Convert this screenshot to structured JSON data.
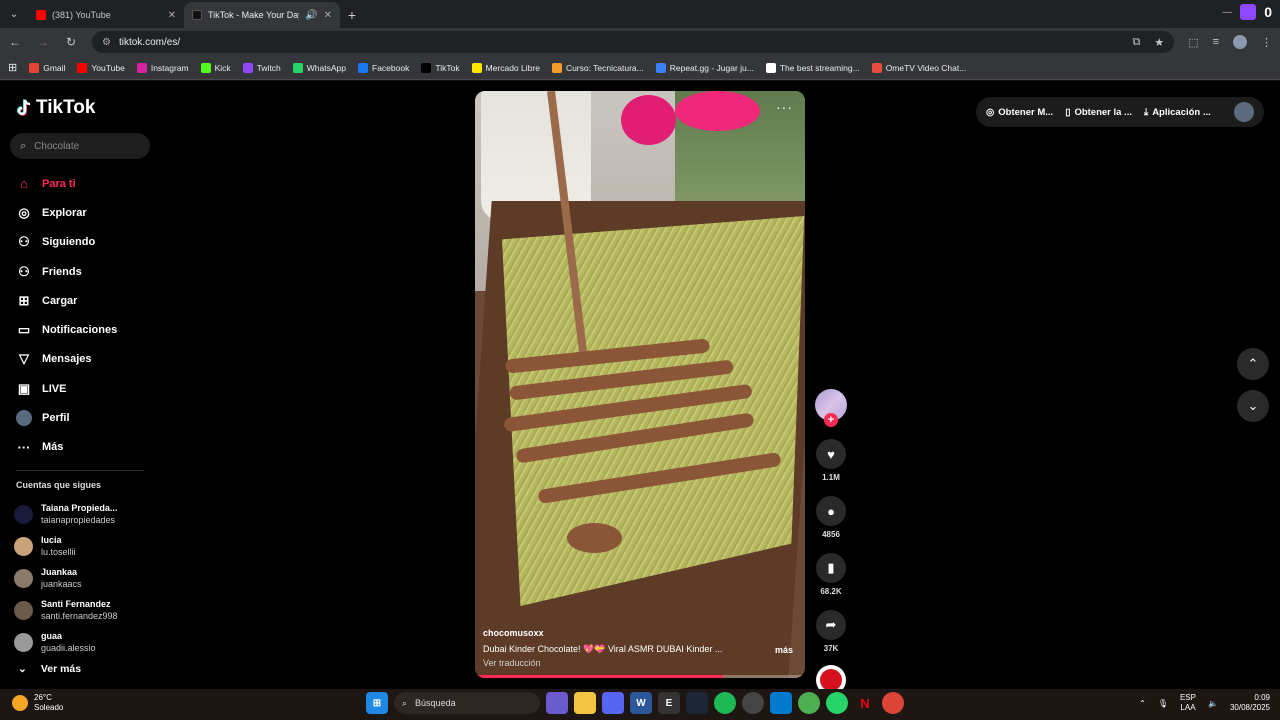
{
  "browser": {
    "tabs": [
      {
        "title": "(381) YouTube",
        "active": false,
        "color": "#ff0000"
      },
      {
        "title": "TikTok - Make Your Day",
        "active": true,
        "color": "#000000"
      }
    ],
    "url": "tiktok.com/es/",
    "bookmarks": [
      {
        "label": "Gmail",
        "color": "#ea4335"
      },
      {
        "label": "YouTube",
        "color": "#ff0000"
      },
      {
        "label": "Instagram",
        "color": "#d6249f"
      },
      {
        "label": "Kick",
        "color": "#53fc18"
      },
      {
        "label": "Twitch",
        "color": "#9146ff"
      },
      {
        "label": "WhatsApp",
        "color": "#25d366"
      },
      {
        "label": "Facebook",
        "color": "#1877f2"
      },
      {
        "label": "TikTok",
        "color": "#000000"
      },
      {
        "label": "Mercado Libre",
        "color": "#ffe600"
      },
      {
        "label": "Curso: Tecnicatura...",
        "color": "#f29b2a"
      },
      {
        "label": "Repeat.gg - Jugar ju...",
        "color": "#3b82f6"
      },
      {
        "label": "The best streaming...",
        "color": "#ffffff"
      },
      {
        "label": "OmeTV Video Chat...",
        "color": "#e74c3c"
      }
    ],
    "badge_count": "0"
  },
  "tiktok": {
    "logo": "TikTok",
    "search_placeholder": "Chocolate",
    "nav": [
      {
        "label": "Para ti",
        "icon": "home-icon",
        "glyph": "⌂",
        "active": true
      },
      {
        "label": "Explorar",
        "icon": "compass-icon",
        "glyph": "◎",
        "active": false
      },
      {
        "label": "Siguiendo",
        "icon": "following-icon",
        "glyph": "⚇",
        "active": false
      },
      {
        "label": "Friends",
        "icon": "friends-icon",
        "glyph": "⚇",
        "active": false
      },
      {
        "label": "Cargar",
        "icon": "upload-icon",
        "glyph": "⊞",
        "active": false
      },
      {
        "label": "Notificaciones",
        "icon": "notifications-icon",
        "glyph": "▭",
        "active": false
      },
      {
        "label": "Mensajes",
        "icon": "messages-icon",
        "glyph": "▽",
        "active": false
      },
      {
        "label": "LIVE",
        "icon": "live-icon",
        "glyph": "▣",
        "active": false
      },
      {
        "label": "Perfil",
        "icon": "profile-icon",
        "glyph": "●",
        "active": false
      },
      {
        "label": "Más",
        "icon": "more-icon",
        "glyph": "···",
        "active": false
      }
    ],
    "following_title": "Cuentas que sigues",
    "following": [
      {
        "name": "Taiana Propieda...",
        "user": "taianapropiedades",
        "color": "#1a1a3a"
      },
      {
        "name": "lucia",
        "user": "lu.tosellii",
        "color": "#c9a27a"
      },
      {
        "name": "Juankaa",
        "user": "juankaacs",
        "color": "#8a7a6a"
      },
      {
        "name": "Santi Fernandez",
        "user": "santi.fernandez998",
        "color": "#6a5a4a"
      },
      {
        "name": "guaa",
        "user": "guadii.alessio",
        "color": "#9a9a9a"
      }
    ],
    "see_more": "Ver más",
    "top_right": {
      "item1": "Obtener M...",
      "item2": "Obtener la ...",
      "item3": "Aplicación ..."
    },
    "video": {
      "author": "chocomusoxx",
      "description": "Dubai Kinder Chocolate! 💖💝 Viral ASMR DUBAI Kinder ...",
      "more": "más",
      "translate": "Ver traducción",
      "progress": 0.75
    },
    "actions": {
      "likes": "1.1M",
      "comments": "4856",
      "saves": "68.2K",
      "shares": "37K"
    }
  },
  "taskbar": {
    "temp": "26°C",
    "weather": "Soleado",
    "search": "Búsqueda",
    "lang1": "ESP",
    "lang2": "LAA",
    "time": "0:09",
    "date": "30/08/2025"
  }
}
